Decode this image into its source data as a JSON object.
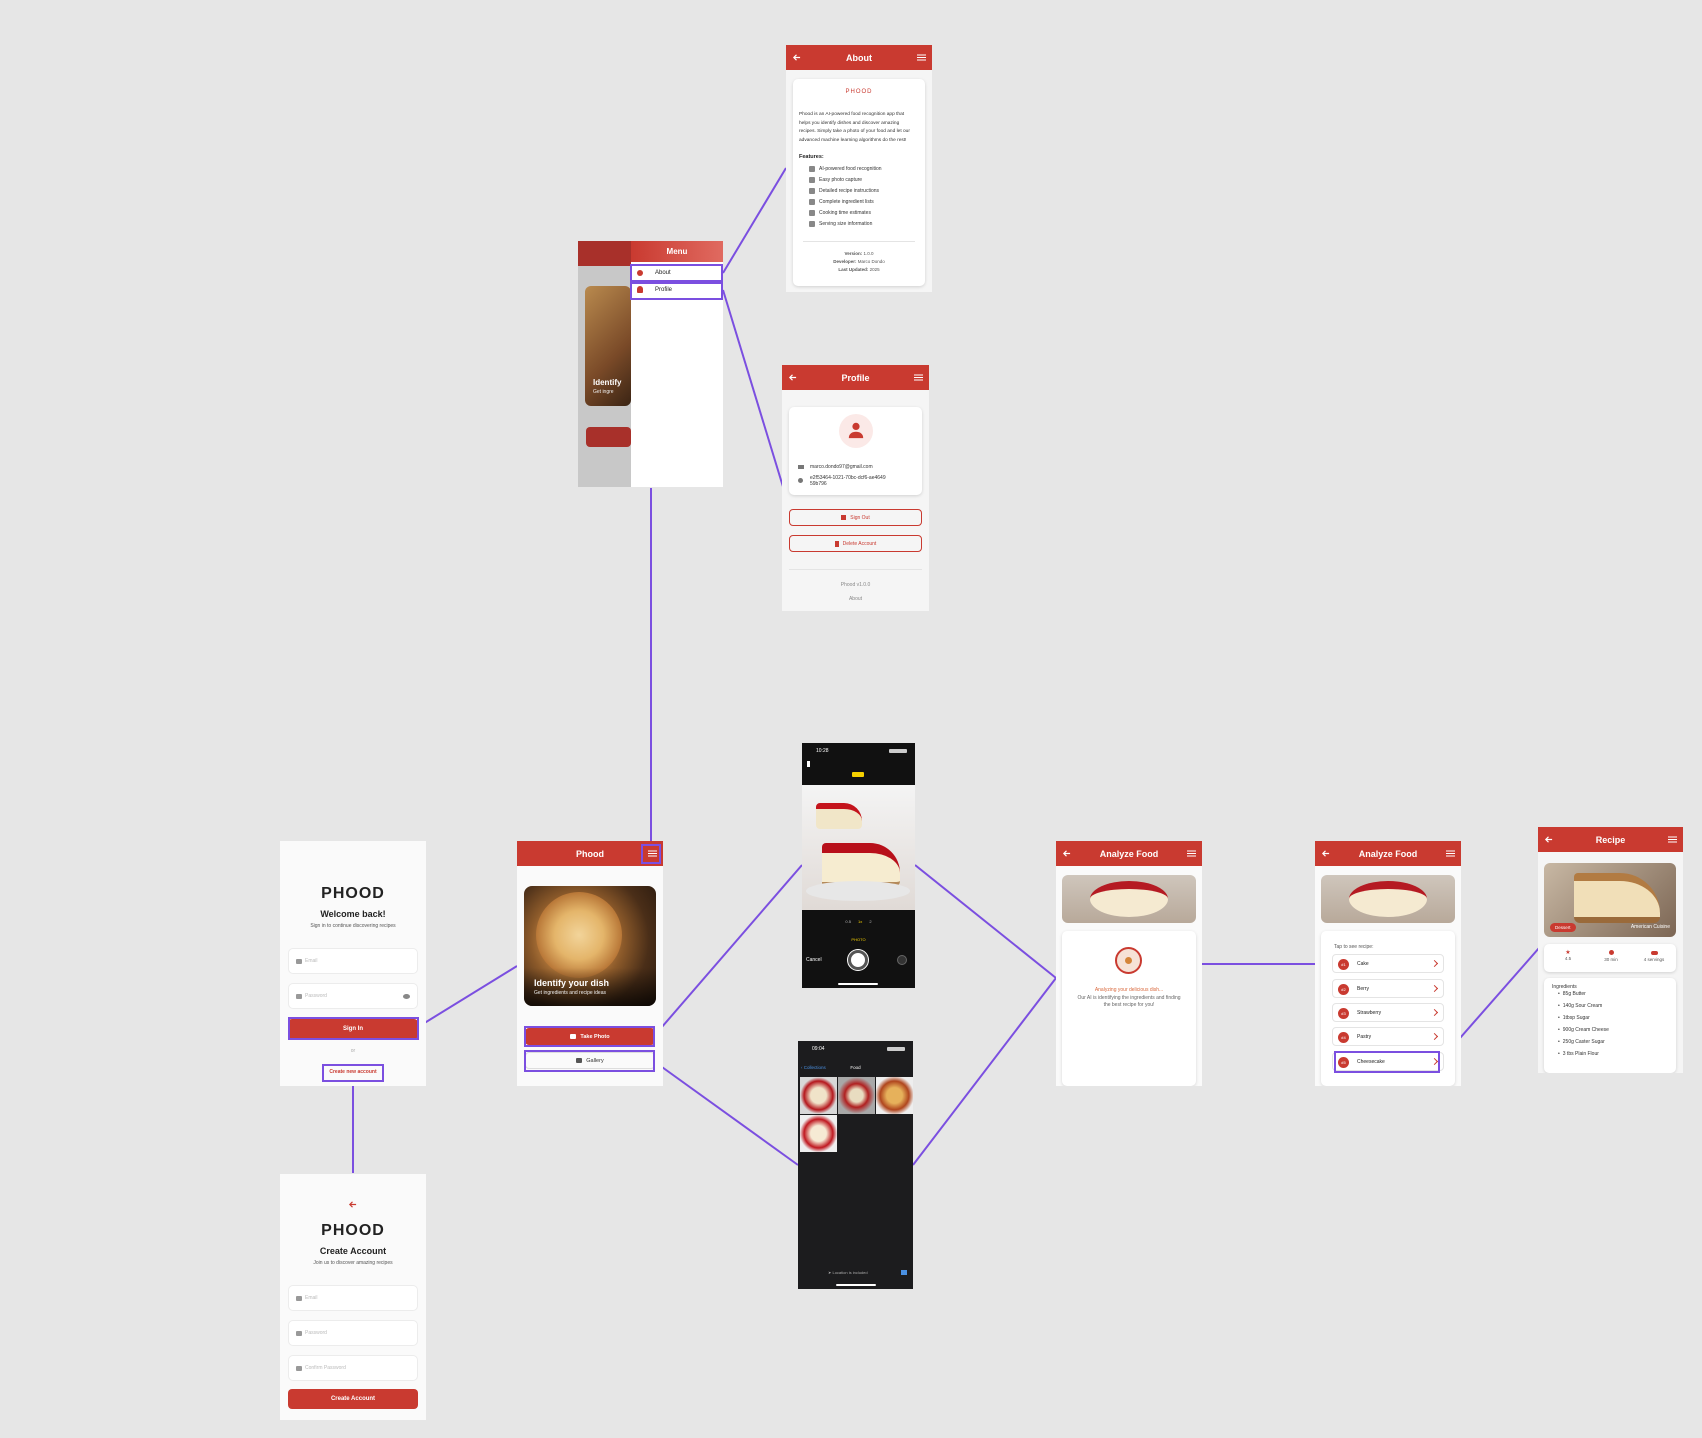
{
  "colors": {
    "accent": "#c93a30",
    "flow_line": "#7b4fe0",
    "canvas": "#e6e6e6"
  },
  "login": {
    "brand": "PHOOD",
    "title": "Welcome back!",
    "subtitle": "Sign in to continue discovering recipes",
    "email_placeholder": "Email",
    "password_placeholder": "Password",
    "signin_label": "Sign In",
    "or_label": "or",
    "create_link": "Create new account"
  },
  "signup": {
    "brand": "PHOOD",
    "title": "Create Account",
    "subtitle": "Join us to discover amazing recipes",
    "email_placeholder": "Email",
    "password_placeholder": "Password",
    "confirm_placeholder": "Confirm Password",
    "button_label": "Create Account"
  },
  "home": {
    "title": "Phood",
    "hero_title": "Identify your dish",
    "hero_subtitle": "Get ingredients and recipe ideas",
    "take_photo_label": "Take Photo",
    "gallery_label": "Gallery"
  },
  "menu": {
    "title": "Menu",
    "items": [
      {
        "label": "About",
        "icon": "info-icon"
      },
      {
        "label": "Profile",
        "icon": "person-icon"
      }
    ],
    "hero_fragment_title": "Identify",
    "hero_fragment_subtitle": "Get ingre"
  },
  "about": {
    "title": "About",
    "brand": "PHOOD",
    "description": "Phood is an AI-powered food recognition app that helps you identify dishes and discover amazing recipes. Simply take a photo of your food and let our advanced machine learning algorithms do the rest!",
    "features_heading": "Features:",
    "features": [
      "AI-powered food recognition",
      "Easy photo capture",
      "Detailed recipe instructions",
      "Complete ingredient lists",
      "Cooking time estimates",
      "Serving size information"
    ],
    "version_label": "Version:",
    "version": "1.0.0",
    "developer_label": "Developer:",
    "developer": "Marco Dondo",
    "updated_label": "Last Updated:",
    "updated": "2025"
  },
  "profile": {
    "title": "Profile",
    "email": "marco.dondo97@gmail.com",
    "user_id": "e2f53464-1021-70bc-dcf6-ae464959b796",
    "sign_out_label": "Sign Out",
    "delete_label": "Delete Account",
    "version": "Phood v1.0.0",
    "about_link": "About"
  },
  "camera": {
    "time": "10:28",
    "modes": [
      "0.5",
      "1x",
      "2"
    ],
    "mode_label": "PHOTO",
    "cancel_label": "Cancel"
  },
  "gallery": {
    "time": "09:04",
    "back_label": "Collections",
    "title": "Food",
    "location_label": "Location is included"
  },
  "analyze": {
    "title": "Analyze Food",
    "status": "Analyzing your delicious dish...",
    "description": "Our AI is identifying the ingredients and finding the best recipe for you!"
  },
  "results": {
    "title": "Analyze Food",
    "tap_label": "Tap to see recipe:",
    "recipes": [
      {
        "num": "#1",
        "name": "Cake"
      },
      {
        "num": "#2",
        "name": "Berry"
      },
      {
        "num": "#3",
        "name": "Strawberry"
      },
      {
        "num": "#4",
        "name": "Pastry"
      },
      {
        "num": "#5",
        "name": "Cheesecake"
      }
    ]
  },
  "recipe": {
    "title": "Recipe",
    "tag": "Dessert",
    "cuisine": "American Cuisine",
    "rating": "4.5",
    "time": "30 min",
    "servings": "4 servings",
    "ingredients_heading": "Ingredients",
    "ingredients": [
      "85g Butter",
      "140g Sour Cream",
      "1tbsp Sugar",
      "900g Cream Cheese",
      "250g Caster Sugar",
      "3 tbs Plain Flour"
    ]
  }
}
